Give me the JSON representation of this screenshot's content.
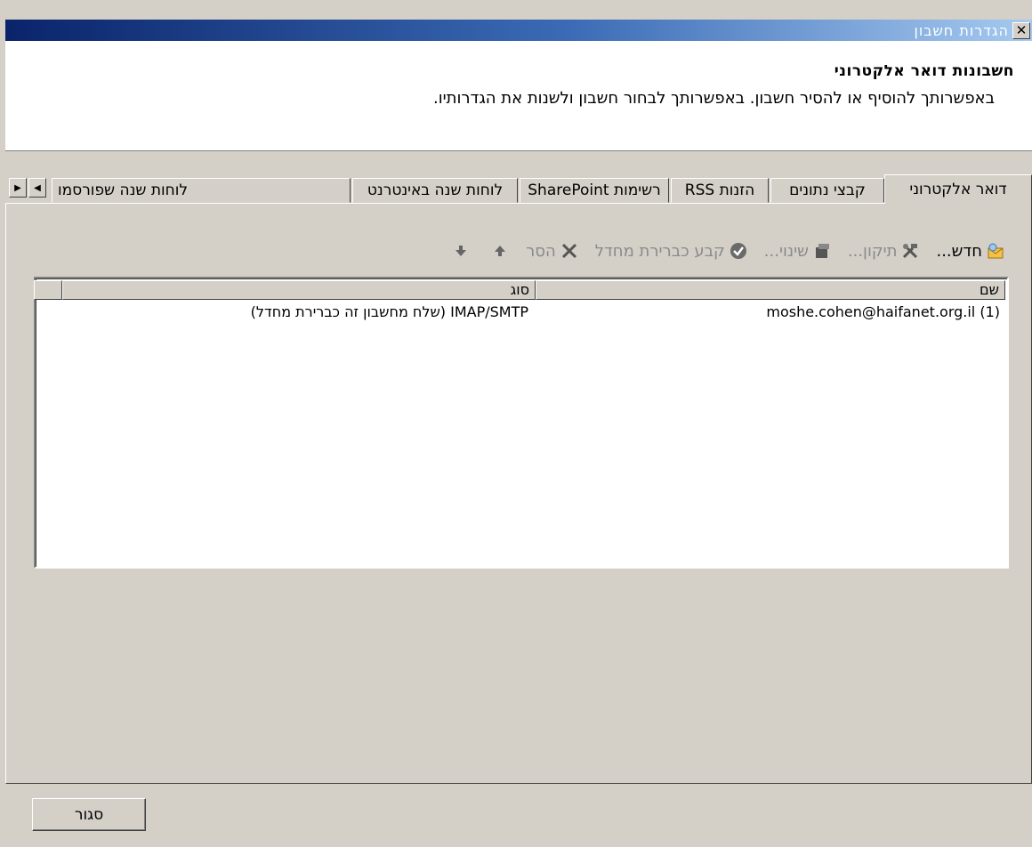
{
  "window": {
    "title": "הגדרות חשבון",
    "close_glyph": "✕"
  },
  "header": {
    "title": "חשבונות דואר אלקטרוני",
    "subtitle": "באפשרותך להוסיף או להסיר חשבון. באפשרותך לבחור חשבון ולשנות את הגדרותיו."
  },
  "tabs": [
    {
      "label": "דואר אלקטרוני",
      "active": true
    },
    {
      "label": "קבצי נתונים",
      "active": false
    },
    {
      "label": "הזנות RSS",
      "active": false
    },
    {
      "label": "רשימות SharePoint",
      "active": false
    },
    {
      "label": "לוחות שנה באינטרנט",
      "active": false
    },
    {
      "label": "לוחות שנה שפורסמו",
      "active": false
    }
  ],
  "toolbar": {
    "new_label": "חדש...",
    "repair_label": "תיקון...",
    "change_label": "שינוי...",
    "set_default_label": "קבע כברירת מחדל",
    "remove_label": "הסר"
  },
  "accounts_table": {
    "columns": [
      "שם",
      "סוג"
    ],
    "rows": [
      {
        "name": "(moshe.cohen@haifanet.org.il (1",
        "type": "IMAP/SMTP (שלח מחשבון זה כברירת מחדל)"
      }
    ]
  },
  "footer": {
    "close_label": "סגור"
  },
  "colors": {
    "title_gradient_start": "#0a246a",
    "title_gradient_end": "#a6caf0",
    "dialog_face": "#d4d0c8",
    "disabled_text": "#8a8a8a"
  }
}
